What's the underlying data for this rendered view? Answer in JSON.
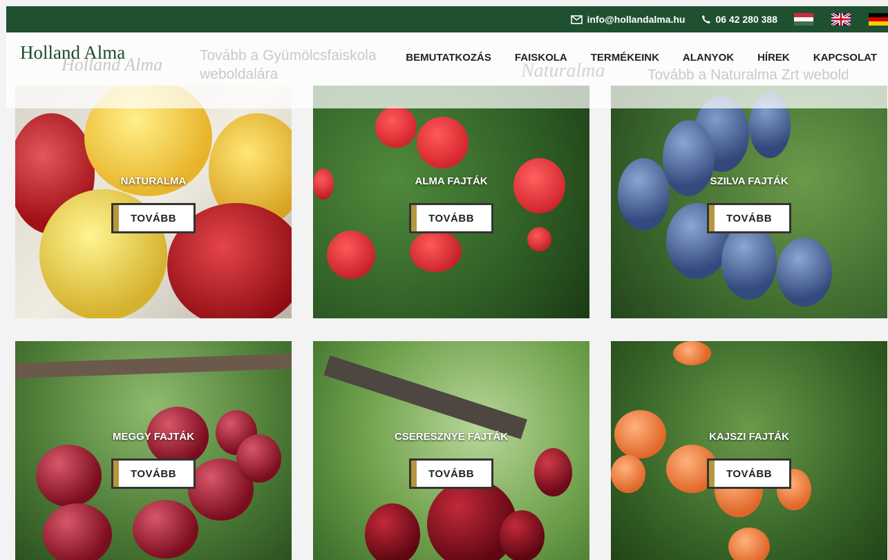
{
  "topbar": {
    "email": "info@hollandalma.hu",
    "phone": "06 42 280 388",
    "email_icon": "envelope-icon",
    "phone_icon": "phone-icon",
    "flags": [
      "flag-hu-icon",
      "flag-uk-icon",
      "flag-de-icon"
    ]
  },
  "header": {
    "logo": "Holland Alma",
    "logo_ghost": "Holland Alma",
    "ghost_left": "Tovább a Gyümölcsfaiskola weboldalára",
    "ghost_right": "Tovább a Naturalma Zrt weboldalára",
    "ghost_brand": "Naturalma"
  },
  "nav": [
    "BEMUTATKOZÁS",
    "FAISKOLA",
    "TERMÉKEINK",
    "ALANYOK",
    "HÍREK",
    "KAPCSOLAT"
  ],
  "cards": [
    {
      "label": "NATURALMA",
      "button": "TOVÁBB"
    },
    {
      "label": "ALMA FAJTÁK",
      "button": "TOVÁBB"
    },
    {
      "label": "SZILVA FAJTÁK",
      "button": "TOVÁBB"
    },
    {
      "label": "MEGGY FAJTÁK",
      "button": "TOVÁBB"
    },
    {
      "label": "CSERESZNYE FAJTÁK",
      "button": "TOVÁBB"
    },
    {
      "label": "KAJSZI FAJTÁK",
      "button": "TOVÁBB"
    }
  ],
  "colors": {
    "topbar": "#1f5130",
    "accent": "#b69740"
  }
}
